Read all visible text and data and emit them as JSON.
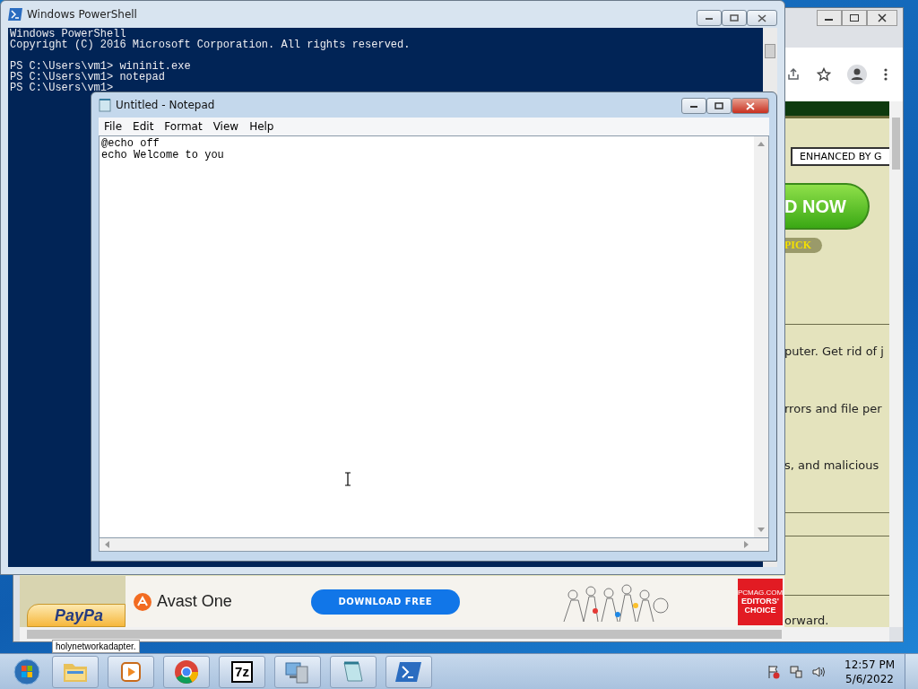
{
  "browser": {
    "search_box": "ENHANCED BY G",
    "cta_button": "D NOW",
    "badge": "PICK",
    "paragraphs": [
      "puter. Get rid of j",
      "rrors and file per",
      "s, and malicious"
    ],
    "footer_text": "orward.",
    "paypal_button": "PayPa",
    "ad": {
      "brand": "Avast One",
      "button": "DOWNLOAD FREE",
      "award_source": "PCMAG.COM",
      "award": "EDITORS' CHOICE"
    },
    "download_item": "holynetworkadapter."
  },
  "powershell": {
    "title": "Windows PowerShell",
    "blocks": [
      [
        "Windows PowerShell",
        "Copyright (C) 2016 Microsoft Corporation. All rights reserved."
      ],
      [
        "PS C:\\Users\\vm1> wininit.exe",
        "PS C:\\Users\\vm1> notepad",
        "PS C:\\Users\\vm1>"
      ]
    ]
  },
  "notepad": {
    "title": "Untitled - Notepad",
    "menu": [
      "File",
      "Edit",
      "Format",
      "View",
      "Help"
    ],
    "lines": [
      "@echo off",
      "echo Welcome to you"
    ]
  },
  "taskbar": {
    "apps": [
      {
        "kind": "folder"
      },
      {
        "kind": "media"
      },
      {
        "kind": "browser"
      },
      {
        "kind": "archiver",
        "label": "7z"
      },
      {
        "kind": "network"
      },
      {
        "kind": "notepad"
      },
      {
        "kind": "shell"
      }
    ],
    "clock": {
      "time": "12:57 PM",
      "date": "5/6/2022"
    }
  }
}
